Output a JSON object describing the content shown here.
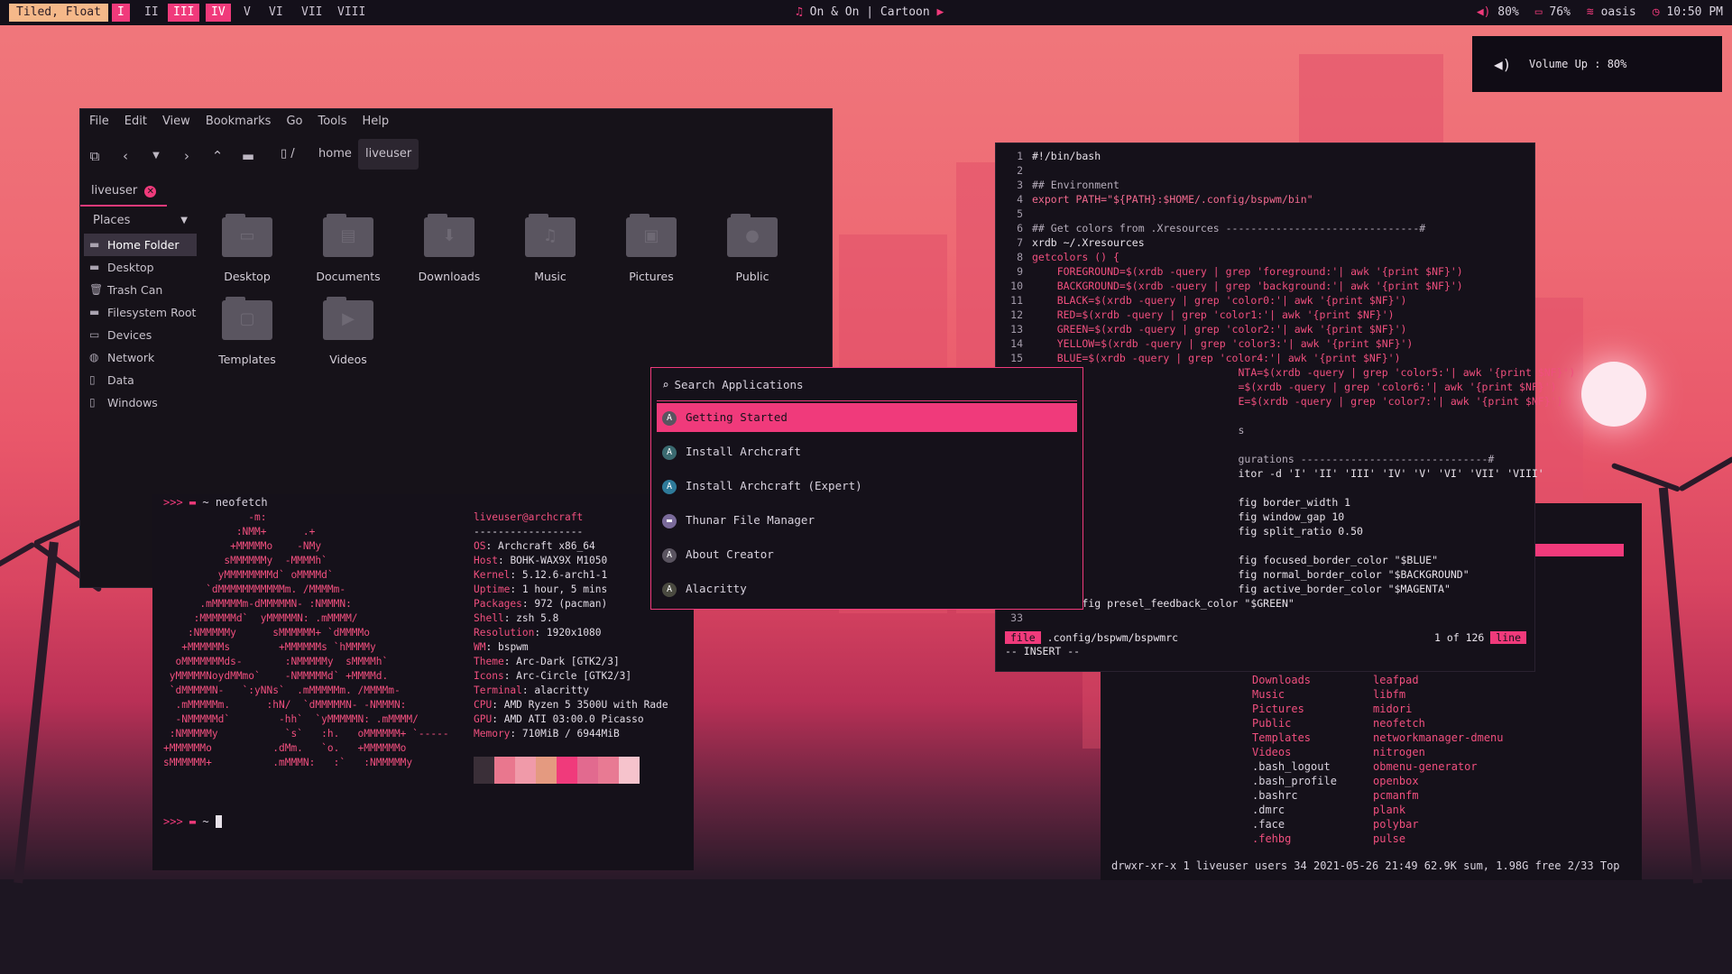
{
  "colors": {
    "accent": "#f03a7b",
    "bar_bg": "#14101a",
    "window_bg": "#15111a",
    "layout_badge": "#f5b889"
  },
  "topbar": {
    "layout_label": "Tiled, Float",
    "workspaces": [
      "I",
      "II",
      "III",
      "IV",
      "V",
      "VI",
      "VII",
      "VIII"
    ],
    "occupied_workspaces": [
      "I",
      "III",
      "IV"
    ],
    "now_playing": "On & On | Cartoon",
    "volume": "80%",
    "battery": "76%",
    "wifi": "oasis",
    "clock": "10:50 PM"
  },
  "notification": {
    "text": "Volume Up : 80%",
    "icon": "speaker-icon"
  },
  "file_manager": {
    "menu": [
      "File",
      "Edit",
      "View",
      "Bookmarks",
      "Go",
      "Tools",
      "Help"
    ],
    "path": {
      "root": "/",
      "crumbs": [
        "home",
        "liveuser"
      ]
    },
    "tab_label": "liveuser",
    "places_label": "Places",
    "sidebar": [
      "Home Folder",
      "Desktop",
      "Trash Can",
      "Filesystem Root",
      "Devices",
      "Network",
      "Data",
      "Windows"
    ],
    "files": [
      "Desktop",
      "Documents",
      "Downloads",
      "Music",
      "Pictures",
      "Public",
      "Templates",
      "Videos"
    ]
  },
  "neofetch": {
    "prompt_1": "~ neofetch",
    "prompt_2": "~",
    "user_host": "liveuser@archcraft",
    "separator": "------------------",
    "info": [
      {
        "k": "OS",
        "v": "Archcraft x86_64"
      },
      {
        "k": "Host",
        "v": "BOHK-WAX9X M1050"
      },
      {
        "k": "Kernel",
        "v": "5.12.6-arch1-1"
      },
      {
        "k": "Uptime",
        "v": "1 hour, 5 mins"
      },
      {
        "k": "Packages",
        "v": "972 (pacman)"
      },
      {
        "k": "Shell",
        "v": "zsh 5.8"
      },
      {
        "k": "Resolution",
        "v": "1920x1080"
      },
      {
        "k": "WM",
        "v": "bspwm"
      },
      {
        "k": "Theme",
        "v": "Arc-Dark [GTK2/3]"
      },
      {
        "k": "Icons",
        "v": "Arc-Circle [GTK2/3]"
      },
      {
        "k": "Terminal",
        "v": "alacritty"
      },
      {
        "k": "CPU",
        "v": "AMD Ryzen 5 3500U with Rade"
      },
      {
        "k": "GPU",
        "v": "AMD ATI 03:00.0 Picasso"
      },
      {
        "k": "Memory",
        "v": "710MiB / 6944MiB"
      }
    ],
    "swatches": [
      "#3a2f38",
      "#e9778e",
      "#f09aa9",
      "#e49a80",
      "#f03a7b",
      "#e26a8f",
      "#e87a93",
      "#f6c3cc"
    ],
    "art": "              -m:\n            :NMM+      .+\n           +MMMMMo    -NMy\n          sMMMMMMy  -MMMMh`\n         yMMMMMMMMd` oMMMMd`\n       `dMMMMMMMMMMMm. /MMMMm-\n      .mMMMMMm-dMMMMMN- :NMMMN:\n     :MMMMMMd`  yMMMMMN: .mMMMM/\n    :NMMMMMy      sMMMMMM+ `dMMMMo\n   +MMMMMMs        +MMMMMMs `hMMMMy\n  oMMMMMMMds-       :NMMMMMy  sMMMMh`\n yMMMMMNoydMMmo`    -NMMMMMd` +MMMMd.\n `dMMMMMN-   `:yNNs`  .mMMMMMm. /MMMMm-\n  .mMMMMMm.      :hN/  `dMMMMMN- -NMMMN:\n  -NMMMMMd`        -hh`  `yMMMMMN: .mMMMM/\n :NMMMMMy           `s`   :h.   oMMMMMM+ `-----\n+MMMMMMo          .dMm.   `o.   +MMMMMMo\nsMMMMMM+          .mMMMN:   :`   :NMMMMMy"
  },
  "editor": {
    "lines": [
      {
        "n": "1",
        "t": "#!/bin/bash",
        "cls": ""
      },
      {
        "n": "2",
        "t": "",
        "cls": ""
      },
      {
        "n": "3",
        "t": "## Environment",
        "cls": "c-comment"
      },
      {
        "n": "4",
        "t": "export PATH=\"${PATH}:$HOME/.config/bspwm/bin\"",
        "cls": "c-str"
      },
      {
        "n": "5",
        "t": "",
        "cls": ""
      },
      {
        "n": "6",
        "t": "## Get colors from .Xresources -------------------------------#",
        "cls": "c-comment"
      },
      {
        "n": "7",
        "t": "xrdb ~/.Xresources",
        "cls": ""
      },
      {
        "n": "8",
        "t": "getcolors () {",
        "cls": "c-pink"
      },
      {
        "n": "9",
        "t": "    FOREGROUND=$(xrdb -query | grep 'foreground:'| awk '{print $NF}')",
        "cls": "c-pink"
      },
      {
        "n": "10",
        "t": "    BACKGROUND=$(xrdb -query | grep 'background:'| awk '{print $NF}')",
        "cls": "c-pink"
      },
      {
        "n": "11",
        "t": "    BLACK=$(xrdb -query | grep 'color0:'| awk '{print $NF}')",
        "cls": "c-pink"
      },
      {
        "n": "12",
        "t": "    RED=$(xrdb -query | grep 'color1:'| awk '{print $NF}')",
        "cls": "c-pink"
      },
      {
        "n": "13",
        "t": "    GREEN=$(xrdb -query | grep 'color2:'| awk '{print $NF}')",
        "cls": "c-pink"
      },
      {
        "n": "14",
        "t": "    YELLOW=$(xrdb -query | grep 'color3:'| awk '{print $NF}')",
        "cls": "c-pink"
      },
      {
        "n": "15",
        "t": "    BLUE=$(xrdb -query | grep 'color4:'| awk '{print $NF}')",
        "cls": "c-pink"
      },
      {
        "n": "",
        "t": "                                 NTA=$(xrdb -query | grep 'color5:'| awk '{print $NF}')",
        "cls": "c-pink"
      },
      {
        "n": "",
        "t": "                                 =$(xrdb -query | grep 'color6:'| awk '{print $NF}')",
        "cls": "c-pink"
      },
      {
        "n": "",
        "t": "                                 E=$(xrdb -query | grep 'color7:'| awk '{print $NF}')",
        "cls": "c-pink"
      },
      {
        "n": "",
        "t": "",
        "cls": ""
      },
      {
        "n": "",
        "t": "                                 s",
        "cls": "c-comment"
      },
      {
        "n": "",
        "t": "",
        "cls": ""
      },
      {
        "n": "",
        "t": "                                 gurations ------------------------------#",
        "cls": "c-comment"
      },
      {
        "n": "",
        "t": "                                 itor -d 'I' 'II' 'III' 'IV' 'V' 'VI' 'VII' 'VIII'",
        "cls": ""
      },
      {
        "n": "",
        "t": "",
        "cls": ""
      },
      {
        "n": "",
        "t": "                                 fig border_width 1",
        "cls": ""
      },
      {
        "n": "",
        "t": "                                 fig window_gap 10",
        "cls": ""
      },
      {
        "n": "",
        "t": "                                 fig split_ratio 0.50",
        "cls": ""
      },
      {
        "n": "",
        "t": "",
        "cls": ""
      },
      {
        "n": "",
        "t": "                                 fig focused_border_color \"$BLUE\"",
        "cls": ""
      },
      {
        "n": "",
        "t": "                                 fig normal_border_color \"$BACKGROUND\"",
        "cls": ""
      },
      {
        "n": "",
        "t": "                                 fig active_border_color \"$MAGENTA\"",
        "cls": ""
      },
      {
        "n": "32",
        "t": "bspc config presel_feedback_color \"$GREEN\"",
        "cls": ""
      },
      {
        "n": "33",
        "t": "",
        "cls": ""
      }
    ],
    "file_tag": "file",
    "file_path": ".config/bspwm/bspwmrc",
    "position": "1 of 126",
    "line_tag": "line",
    "mode": "-- INSERT --"
  },
  "filelist": {
    "col1": [
      {
        "t": "Downloads",
        "d": true
      },
      {
        "t": "Music",
        "d": true
      },
      {
        "t": "Pictures",
        "d": true
      },
      {
        "t": "Public",
        "d": true
      },
      {
        "t": "Templates",
        "d": true
      },
      {
        "t": "Videos",
        "d": true
      },
      {
        "t": ".bash_logout",
        "d": false
      },
      {
        "t": ".bash_profile",
        "d": false
      },
      {
        "t": ".bashrc",
        "d": false
      },
      {
        "t": ".dmrc",
        "d": false
      },
      {
        "t": ".face",
        "d": false
      },
      {
        "t": ".fehbg",
        "d": true
      }
    ],
    "col2": [
      "leafpad",
      "libfm",
      "midori",
      "neofetch",
      "networkmanager-dmenu",
      "nitrogen",
      "obmenu-generator",
      "openbox",
      "pcmanfm",
      "plank",
      "polybar",
      "pulse"
    ],
    "footer": "drwxr-xr-x 1 liveuser users 34 2021-05-26 21:49    62.9K sum, 1.98G free  2/33   Top"
  },
  "launcher": {
    "placeholder": "Search Applications",
    "items": [
      "Getting Started",
      "Install Archcraft",
      "Install Archcraft (Expert)",
      "Thunar File Manager",
      "About Creator",
      "Alacritty"
    ]
  }
}
